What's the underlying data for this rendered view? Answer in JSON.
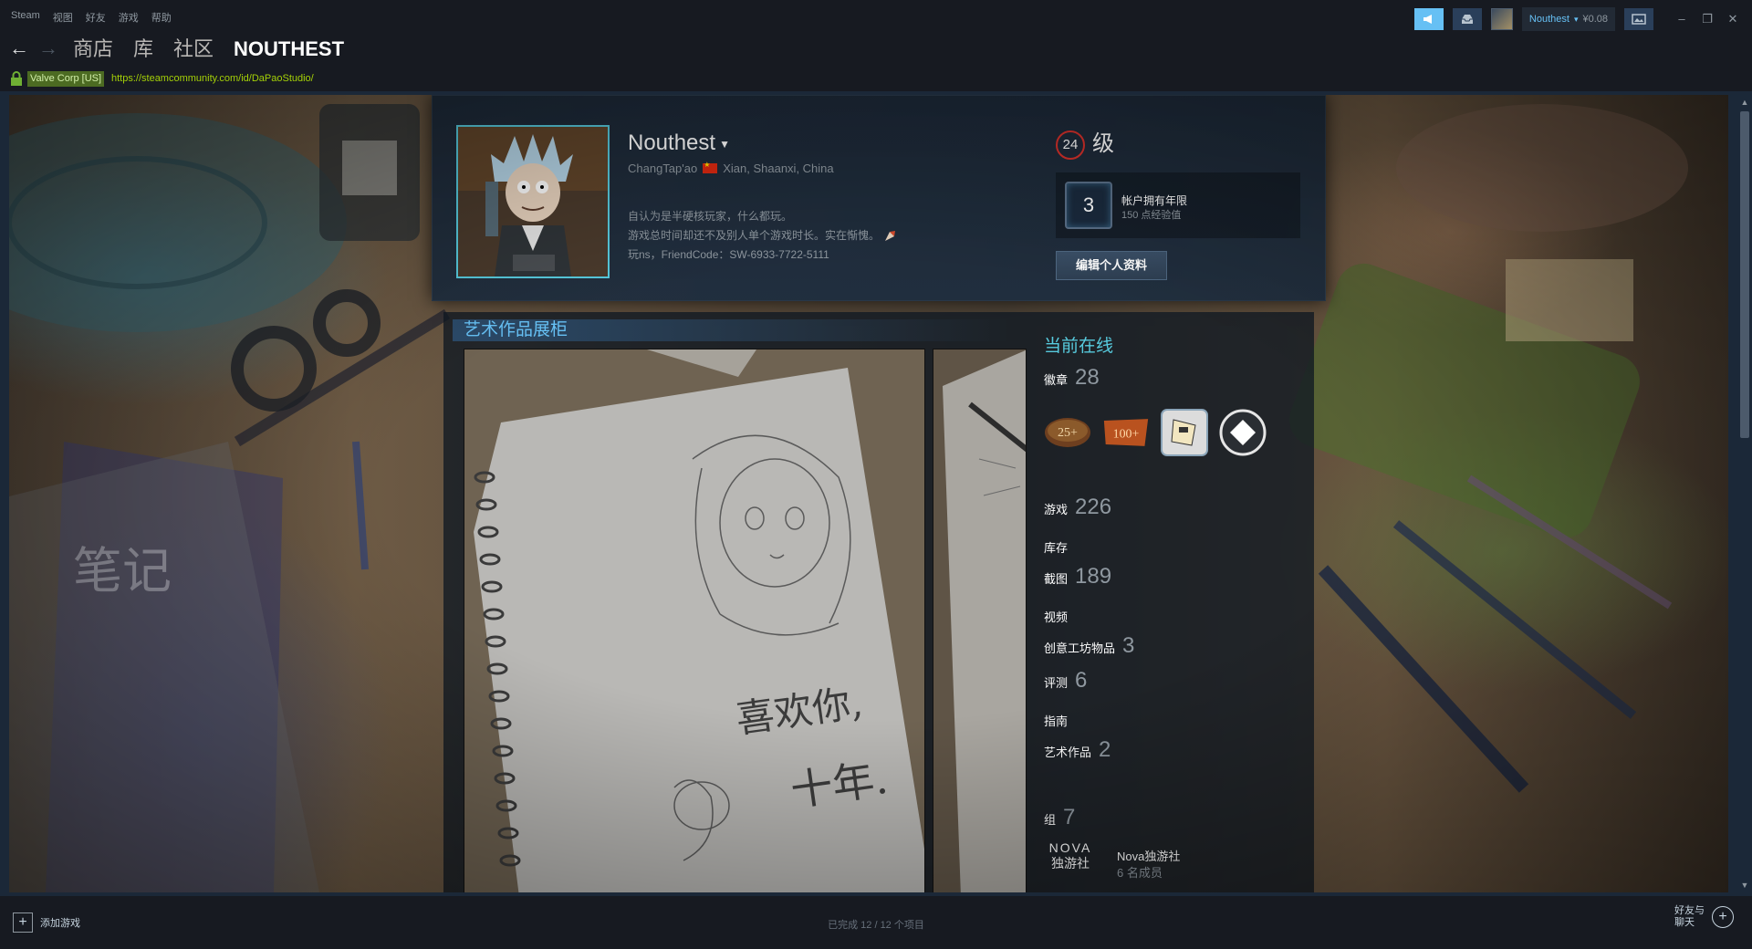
{
  "menu": [
    "Steam",
    "视图",
    "好友",
    "游戏",
    "帮助"
  ],
  "titlebar": {
    "username": "Nouthest",
    "wallet": "¥0.08",
    "icons": [
      "announcement-icon",
      "inbox-icon",
      "screenshot-icon"
    ]
  },
  "nav": {
    "links": [
      "商店",
      "库",
      "社区"
    ],
    "active": "NOUTHEST"
  },
  "urlbar": {
    "certificate": "Valve Corp [US]",
    "url": "https://steamcommunity.com/id/DaPaoStudio/"
  },
  "profile": {
    "persona_name": "Nouthest",
    "real_name": "ChangTap'ao",
    "location": "Xian, Shaanxi, China",
    "summary": [
      "自认为是半硬核玩家，什么都玩。",
      "游戏总时间却还不及别人单个游戏时长。实在惭愧。",
      "玩ns，FriendCode：SW-6933-7722-5111"
    ],
    "level": "24",
    "level_suffix": "级",
    "years_badge_value": "3",
    "years_badge_title": "帐户拥有年限",
    "years_badge_xp": "150 点经验值",
    "edit_button": "编辑个人资料"
  },
  "showcase": {
    "title": "艺术作品展柜",
    "artwork_text": [
      "喜欢你,",
      "十年."
    ]
  },
  "sidebar": {
    "status": "当前在线",
    "badges_label": "徽章",
    "badges_count": "28",
    "badge_labels": [
      "25+",
      "100+"
    ],
    "stats": [
      {
        "label": "游戏",
        "count": "226"
      },
      {
        "label": "库存",
        "count": ""
      },
      {
        "label": "截图",
        "count": "189"
      },
      {
        "label": "视频",
        "count": ""
      },
      {
        "label": "创意工坊物品",
        "count": "3"
      },
      {
        "label": "评测",
        "count": "6"
      },
      {
        "label": "指南",
        "count": ""
      },
      {
        "label": "艺术作品",
        "count": "2"
      }
    ],
    "groups_label": "组",
    "groups_count": "7",
    "group_logo_line1": "NOVA",
    "group_logo_line2": "独游社",
    "group_name": "Nova独游社",
    "group_members": "6 名成员"
  },
  "bottombar": {
    "add_game": "添加游戏",
    "status": "已完成 12 / 12 个项目",
    "friends_line1": "好友与",
    "friends_line2": "聊天"
  },
  "colors": {
    "accent": "#66c0f4",
    "online": "#57cbde",
    "level_ring": "#d9312b",
    "url": "#a4d007"
  }
}
